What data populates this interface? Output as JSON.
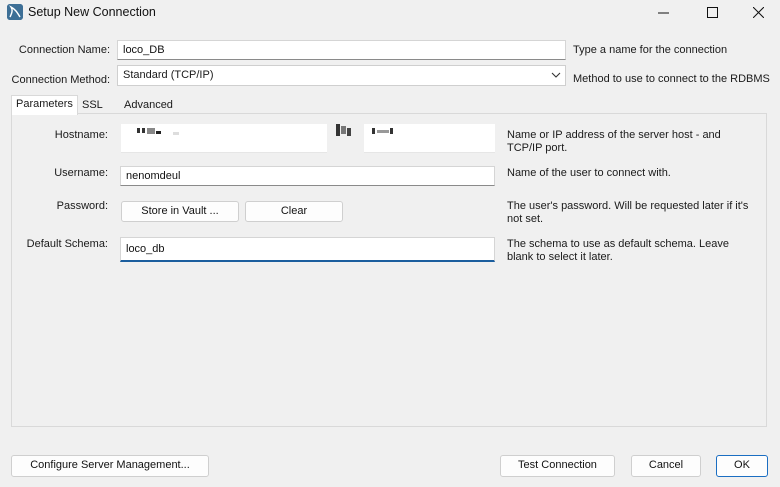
{
  "window": {
    "title": "Setup New Connection"
  },
  "form": {
    "connection_name": {
      "label": "Connection Name:",
      "value": "loco_DB",
      "help": "Type a name for the connection"
    },
    "connection_method": {
      "label": "Connection Method:",
      "value": "Standard (TCP/IP)",
      "help": "Method to use to connect to the RDBMS"
    }
  },
  "tabs": [
    {
      "label": "Parameters",
      "active": true
    },
    {
      "label": "SSL",
      "active": false
    },
    {
      "label": "Advanced",
      "active": false
    }
  ],
  "parameters": {
    "hostname": {
      "label": "Hostname:",
      "help_line1": "Name or IP address of the server host - and",
      "help_line2": "TCP/IP port."
    },
    "username": {
      "label": "Username:",
      "value": "nenomdeul",
      "help": "Name of the user to connect with."
    },
    "password": {
      "label": "Password:",
      "store_button": "Store in Vault ...",
      "clear_button": "Clear",
      "help_line1": "The user's password. Will be requested later if it's",
      "help_line2": "not set."
    },
    "default_schema": {
      "label": "Default Schema:",
      "value": "loco_db",
      "help_line1": "The schema to use as default schema. Leave",
      "help_line2": "blank to select it later."
    }
  },
  "footer": {
    "configure_button": "Configure Server Management...",
    "test_button": "Test Connection",
    "cancel_button": "Cancel",
    "ok_button": "OK"
  },
  "colors": {
    "accent": "#1b5e9e",
    "background": "#f0f0f0"
  },
  "icons": {
    "app": "mysql-workbench-icon",
    "minimize": "minimize-icon",
    "maximize": "maximize-icon",
    "close": "close-icon",
    "dropdown": "chevron-down-icon"
  }
}
